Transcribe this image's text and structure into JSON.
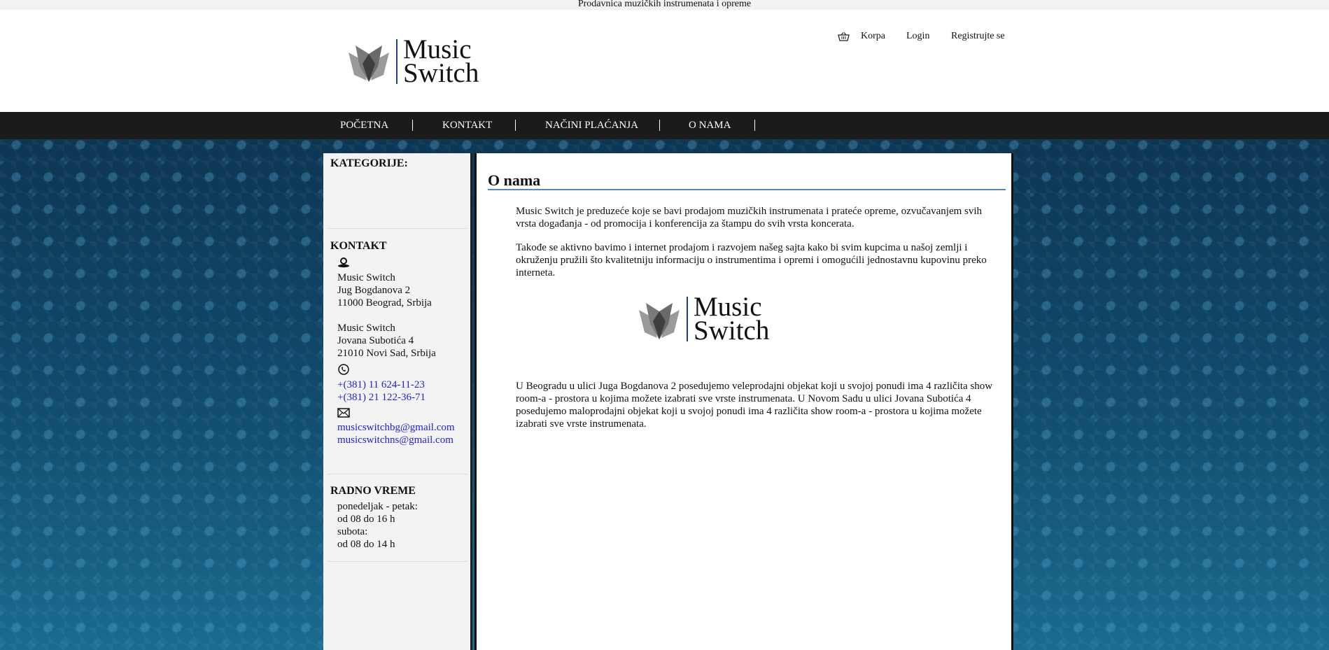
{
  "topbar": {
    "text": "Prodavnica muzičkih instrumenata i opreme"
  },
  "logo": {
    "line1": "Music",
    "line2": "Switch"
  },
  "toplinks": {
    "cart": "Korpa",
    "login": "Login",
    "register": "Registrujte se"
  },
  "nav": [
    "POČETNA",
    "KONTAKT",
    "NAČINI PLAĆANJA",
    "O NAMA"
  ],
  "sidebar": {
    "categories_title": "KATEGORIJE:",
    "contact_title": "KONTAKT",
    "address1": [
      "Music Switch",
      "Jug Bogdanova 2",
      "11000 Beograd, Srbija"
    ],
    "address2": [
      "Music Switch",
      "Jovana Subotića 4",
      "21010 Novi Sad, Srbija"
    ],
    "phones": [
      "+(381) 11 624-11-23",
      "+(381) 21 122-36-71"
    ],
    "emails": [
      "musicswitchbg@gmail.com",
      "musicswitchns@gmail.com"
    ],
    "hours_title": "RADNO VREME",
    "hours": [
      "ponedeljak - petak:",
      "od 08 do 16 h",
      "subota:",
      "od 08 do 14 h"
    ]
  },
  "content": {
    "title": "O nama",
    "p1": "Music Switch je preduzeće koje se bavi prodajom muzičkih instrumenata i prateće opreme, ozvučavanjem svih vrsta događanja - od promocija i konferencija za štampu do svih vrsta koncerata.",
    "p2": "Takođe se aktivno bavimo i internet prodajom i razvojem našeg sajta kako bi svim kupcima u našoj zemlji i okruženju pružili što kvalitetniju informaciju o instrumentima i opremi i omogućili jednostavnu kupovinu preko interneta.",
    "p3": "U Beogradu u ulici Juga Bogdanova 2 posedujemo veleprodajni objekat koji u svojoj ponudi ima 4 različita show room-a - prostora u kojima možete izabrati sve vrste instrumenata. U Novom Sadu u ulici Jovana Subotića 4 posedujemo maloprodajni objekat koji u svojoj ponudi ima 4 različita show room-a - prostora u kojima možete izabrati sve vrste instrumenata."
  }
}
